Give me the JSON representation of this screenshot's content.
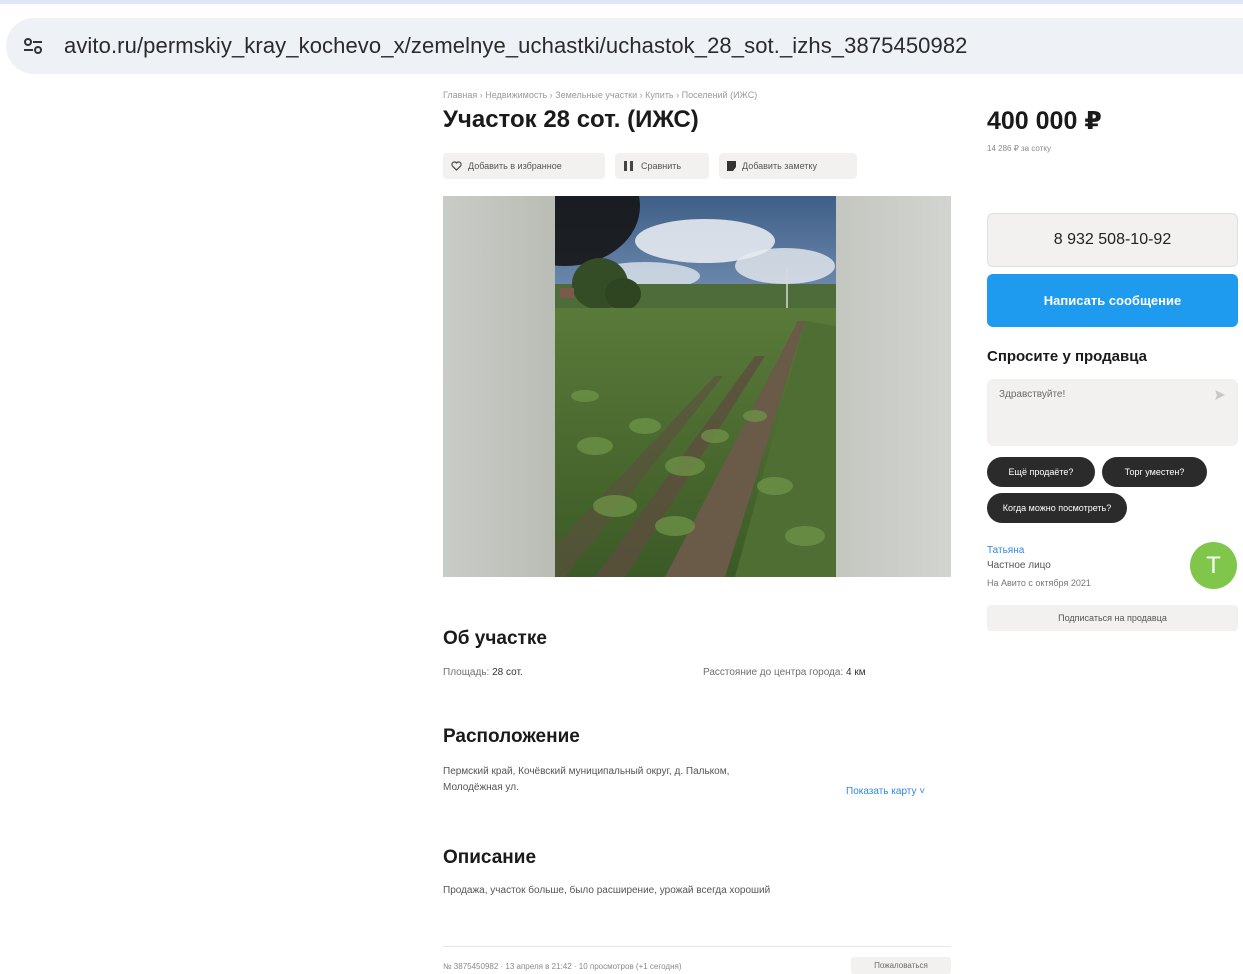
{
  "browser": {
    "url": "avito.ru/permskiy_kray_kochevo_x/zemelnye_uchastki/uchastok_28_sot._izhs_3875450982",
    "site_info_icon": "tune-icon"
  },
  "breadcrumb": "Главная › Недвижимость › Земельные участки › Купить › Поселений (ИЖС)",
  "listing": {
    "title": "Участок 28 сот. (ИЖС)",
    "actions": {
      "favorite": "Добавить в избранное",
      "compare": "Сравнить",
      "note": "Добавить заметку"
    }
  },
  "about": {
    "heading": "Об участке",
    "area_label": "Площадь:",
    "area_value": "28 сот.",
    "distance_label": "Расстояние до центра города:",
    "distance_value": "4 км"
  },
  "location": {
    "heading": "Расположение",
    "address_line1": "Пермский край, Кочёвский муниципальный округ, д. Пальком,",
    "address_line2": "Молодёжная ул.",
    "show_map": "Показать карту ˅"
  },
  "description": {
    "heading": "Описание",
    "text": "Продажа, участок больше, было расширение, урожай всегда хороший"
  },
  "footer": {
    "meta": "№ 3875450982 · 13 апреля в 21:42 · 10 просмотров (+1 сегодня)",
    "complain": "Пожаловаться"
  },
  "sidebar": {
    "price": "400 000 ₽",
    "price_per_sot": "14 286 ₽ за сотку",
    "phone": "8 932 508-10-92",
    "message_button": "Написать сообщение",
    "ask_title": "Спросите у продавца",
    "ask_placeholder": "Здравствуйте!",
    "quick_questions": [
      "Ещё продаёте?",
      "Торг уместен?",
      "Когда можно посмотреть?"
    ],
    "seller": {
      "name": "Татьяна",
      "type": "Частное лицо",
      "since": "На Авито с октября 2021",
      "avatar_letter": "Т"
    },
    "subscribe": "Подписаться на продавца"
  },
  "colors": {
    "accent_blue": "#1e9aef",
    "link_blue": "#2f86e6",
    "avatar_green": "#7fc64b",
    "chip_dark": "#2b2b2b"
  }
}
